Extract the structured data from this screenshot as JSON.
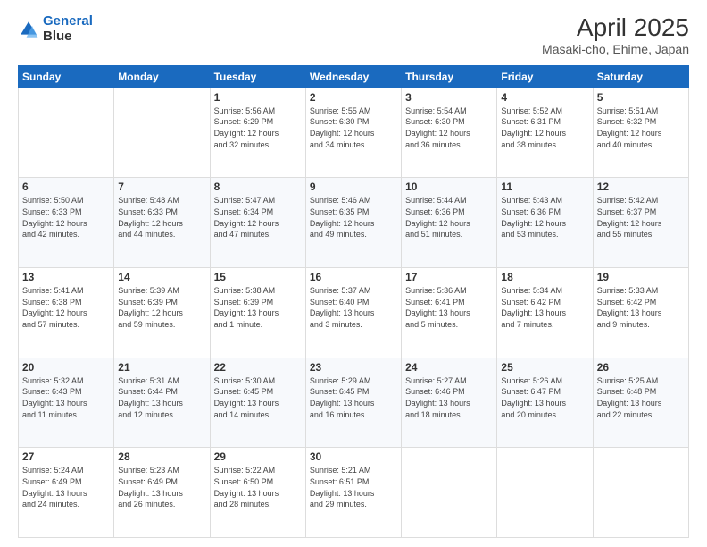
{
  "logo": {
    "line1": "General",
    "line2": "Blue"
  },
  "title": "April 2025",
  "subtitle": "Masaki-cho, Ehime, Japan",
  "days_header": [
    "Sunday",
    "Monday",
    "Tuesday",
    "Wednesday",
    "Thursday",
    "Friday",
    "Saturday"
  ],
  "weeks": [
    [
      {
        "num": "",
        "info": ""
      },
      {
        "num": "",
        "info": ""
      },
      {
        "num": "1",
        "info": "Sunrise: 5:56 AM\nSunset: 6:29 PM\nDaylight: 12 hours\nand 32 minutes."
      },
      {
        "num": "2",
        "info": "Sunrise: 5:55 AM\nSunset: 6:30 PM\nDaylight: 12 hours\nand 34 minutes."
      },
      {
        "num": "3",
        "info": "Sunrise: 5:54 AM\nSunset: 6:30 PM\nDaylight: 12 hours\nand 36 minutes."
      },
      {
        "num": "4",
        "info": "Sunrise: 5:52 AM\nSunset: 6:31 PM\nDaylight: 12 hours\nand 38 minutes."
      },
      {
        "num": "5",
        "info": "Sunrise: 5:51 AM\nSunset: 6:32 PM\nDaylight: 12 hours\nand 40 minutes."
      }
    ],
    [
      {
        "num": "6",
        "info": "Sunrise: 5:50 AM\nSunset: 6:33 PM\nDaylight: 12 hours\nand 42 minutes."
      },
      {
        "num": "7",
        "info": "Sunrise: 5:48 AM\nSunset: 6:33 PM\nDaylight: 12 hours\nand 44 minutes."
      },
      {
        "num": "8",
        "info": "Sunrise: 5:47 AM\nSunset: 6:34 PM\nDaylight: 12 hours\nand 47 minutes."
      },
      {
        "num": "9",
        "info": "Sunrise: 5:46 AM\nSunset: 6:35 PM\nDaylight: 12 hours\nand 49 minutes."
      },
      {
        "num": "10",
        "info": "Sunrise: 5:44 AM\nSunset: 6:36 PM\nDaylight: 12 hours\nand 51 minutes."
      },
      {
        "num": "11",
        "info": "Sunrise: 5:43 AM\nSunset: 6:36 PM\nDaylight: 12 hours\nand 53 minutes."
      },
      {
        "num": "12",
        "info": "Sunrise: 5:42 AM\nSunset: 6:37 PM\nDaylight: 12 hours\nand 55 minutes."
      }
    ],
    [
      {
        "num": "13",
        "info": "Sunrise: 5:41 AM\nSunset: 6:38 PM\nDaylight: 12 hours\nand 57 minutes."
      },
      {
        "num": "14",
        "info": "Sunrise: 5:39 AM\nSunset: 6:39 PM\nDaylight: 12 hours\nand 59 minutes."
      },
      {
        "num": "15",
        "info": "Sunrise: 5:38 AM\nSunset: 6:39 PM\nDaylight: 13 hours\nand 1 minute."
      },
      {
        "num": "16",
        "info": "Sunrise: 5:37 AM\nSunset: 6:40 PM\nDaylight: 13 hours\nand 3 minutes."
      },
      {
        "num": "17",
        "info": "Sunrise: 5:36 AM\nSunset: 6:41 PM\nDaylight: 13 hours\nand 5 minutes."
      },
      {
        "num": "18",
        "info": "Sunrise: 5:34 AM\nSunset: 6:42 PM\nDaylight: 13 hours\nand 7 minutes."
      },
      {
        "num": "19",
        "info": "Sunrise: 5:33 AM\nSunset: 6:42 PM\nDaylight: 13 hours\nand 9 minutes."
      }
    ],
    [
      {
        "num": "20",
        "info": "Sunrise: 5:32 AM\nSunset: 6:43 PM\nDaylight: 13 hours\nand 11 minutes."
      },
      {
        "num": "21",
        "info": "Sunrise: 5:31 AM\nSunset: 6:44 PM\nDaylight: 13 hours\nand 12 minutes."
      },
      {
        "num": "22",
        "info": "Sunrise: 5:30 AM\nSunset: 6:45 PM\nDaylight: 13 hours\nand 14 minutes."
      },
      {
        "num": "23",
        "info": "Sunrise: 5:29 AM\nSunset: 6:45 PM\nDaylight: 13 hours\nand 16 minutes."
      },
      {
        "num": "24",
        "info": "Sunrise: 5:27 AM\nSunset: 6:46 PM\nDaylight: 13 hours\nand 18 minutes."
      },
      {
        "num": "25",
        "info": "Sunrise: 5:26 AM\nSunset: 6:47 PM\nDaylight: 13 hours\nand 20 minutes."
      },
      {
        "num": "26",
        "info": "Sunrise: 5:25 AM\nSunset: 6:48 PM\nDaylight: 13 hours\nand 22 minutes."
      }
    ],
    [
      {
        "num": "27",
        "info": "Sunrise: 5:24 AM\nSunset: 6:49 PM\nDaylight: 13 hours\nand 24 minutes."
      },
      {
        "num": "28",
        "info": "Sunrise: 5:23 AM\nSunset: 6:49 PM\nDaylight: 13 hours\nand 26 minutes."
      },
      {
        "num": "29",
        "info": "Sunrise: 5:22 AM\nSunset: 6:50 PM\nDaylight: 13 hours\nand 28 minutes."
      },
      {
        "num": "30",
        "info": "Sunrise: 5:21 AM\nSunset: 6:51 PM\nDaylight: 13 hours\nand 29 minutes."
      },
      {
        "num": "",
        "info": ""
      },
      {
        "num": "",
        "info": ""
      },
      {
        "num": "",
        "info": ""
      }
    ]
  ]
}
